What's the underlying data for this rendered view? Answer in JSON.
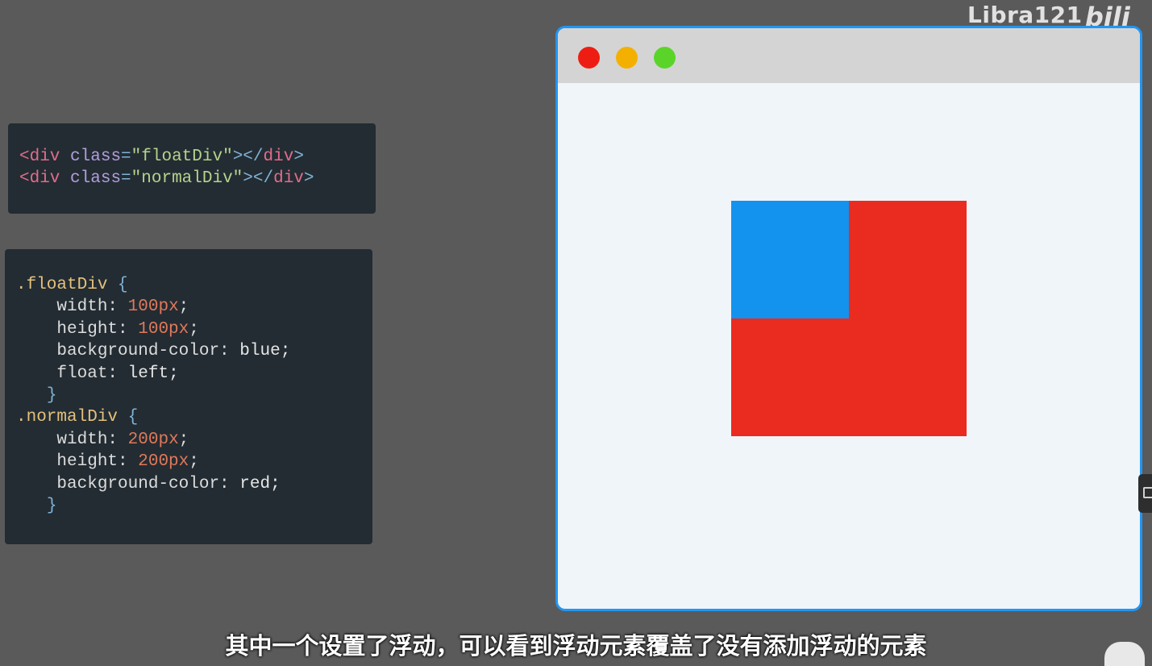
{
  "watermark": {
    "text": "Libra121",
    "logo": "bili"
  },
  "html_code": {
    "line1": {
      "open_tag": "<div",
      "attr": "class",
      "eq": "=",
      "value": "\"floatDiv\"",
      "close": "></",
      "tag": "div",
      "end": ">"
    },
    "line2": {
      "open_tag": "<div",
      "attr": "class",
      "eq": "=",
      "value": "\"normalDiv\"",
      "close": "></",
      "tag": "div",
      "end": ">"
    }
  },
  "css_code": {
    "float_selector": ".floatDiv",
    "float_open": "{",
    "float_width_prop": "width:",
    "float_width_val": "100px",
    "float_height_prop": "height:",
    "float_height_val": "100px",
    "float_bg_prop": "background-color:",
    "float_bg_val": "blue;",
    "float_float_prop": "float:",
    "float_float_val": "left;",
    "float_close": "}",
    "normal_selector": ".normalDiv",
    "normal_open": "{",
    "normal_width_prop": "width:",
    "normal_width_val": "200px",
    "normal_height_prop": "height:",
    "normal_height_val": "200px",
    "normal_bg_prop": "background-color:",
    "normal_bg_val": "red;",
    "normal_close": "}",
    "semicolon": ";"
  },
  "browser": {
    "close_color": "#ee1d13",
    "minimize_color": "#f4b000",
    "maximize_color": "#5bd42a",
    "border_color": "#2196f3"
  },
  "demo": {
    "float_div_color": "#1392ee",
    "normal_div_color": "#ea2b1f"
  },
  "subtitle": "其中一个设置了浮动，可以看到浮动元素覆盖了没有添加浮动的元素"
}
